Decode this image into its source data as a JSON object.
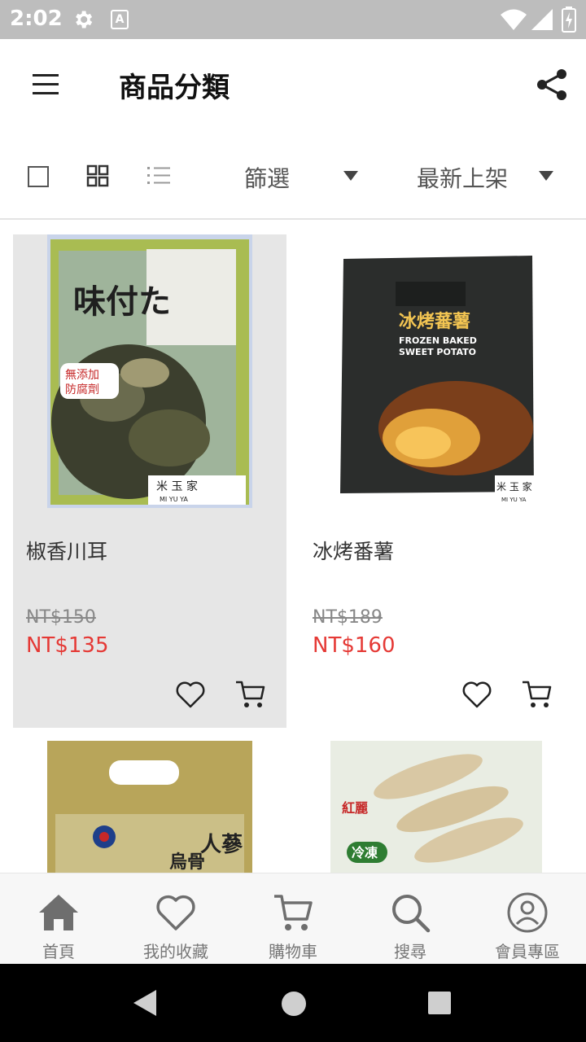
{
  "status_bar": {
    "time": "2:02",
    "a_label": "A"
  },
  "app_bar": {
    "title": "商品分類"
  },
  "toolbar": {
    "filter_label": "篩選",
    "sort_label": "最新上架"
  },
  "products": [
    {
      "name": "椒香川耳",
      "original_price": "NT$150",
      "sale_price": "NT$135",
      "package_labels": [
        "味付た",
        "無添加",
        "防腐劑",
        "米 玉 家",
        "MI YU YA"
      ]
    },
    {
      "name": "冰烤番薯",
      "original_price": "NT$189",
      "sale_price": "NT$160",
      "package_labels": [
        "冰烤蕃薯",
        "FROZEN BAKED",
        "SWEET POTATO",
        "米 玉 家",
        "MI YU YA"
      ]
    },
    {
      "package_labels": [
        "人蔘",
        "烏骨"
      ]
    },
    {
      "package_labels": [
        "冷凍",
        "紅麗"
      ]
    }
  ],
  "bottom_nav": [
    {
      "label": "首頁",
      "icon": "home-icon"
    },
    {
      "label": "我的收藏",
      "icon": "heart-icon"
    },
    {
      "label": "購物車",
      "icon": "cart-icon"
    },
    {
      "label": "搜尋",
      "icon": "search-icon"
    },
    {
      "label": "會員專區",
      "icon": "account-icon"
    }
  ],
  "colors": {
    "sale_price": "#e53935",
    "status_bar": "#bdbdbd",
    "card_highlight": "#e6e6e6"
  }
}
